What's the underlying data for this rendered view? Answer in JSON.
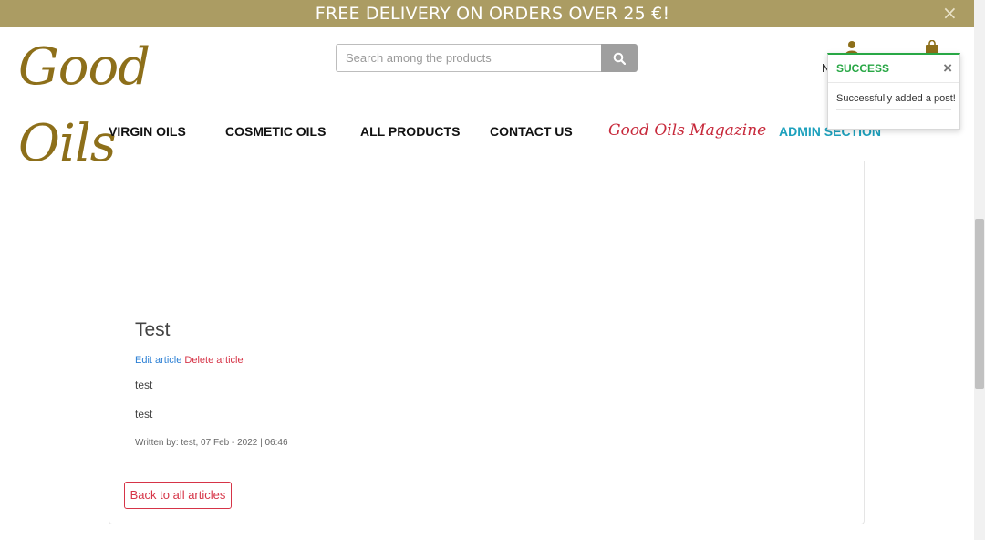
{
  "promo": {
    "text": "FREE DELIVERY ON ORDERS OVER 25 €!",
    "close": "×"
  },
  "logo": {
    "text": "Good Oils"
  },
  "search": {
    "placeholder": "Search among the products",
    "icon": "search-icon"
  },
  "nav": {
    "items": [
      {
        "label": "VIRGIN OILS"
      },
      {
        "label": "COSMETIC OILS"
      },
      {
        "label": "ALL PRODUCTS"
      },
      {
        "label": "CONTACT US"
      },
      {
        "label": "Good Oils Magazine"
      },
      {
        "label": "ADMIN SECTION"
      }
    ]
  },
  "header_right": {
    "user_partial": "N"
  },
  "toast": {
    "title": "SUCCESS",
    "close": "×",
    "message": "Successfully added a post!"
  },
  "article": {
    "title": "Test",
    "edit": "Edit article",
    "delete": "Delete article",
    "paragraphs": [
      "test",
      "test"
    ],
    "meta": "Written by: test, 07 Feb - 2022 | 06:46",
    "back": "Back to all articles"
  },
  "colors": {
    "promo_bg": "#ab9c63",
    "logo": "#8d6f1a",
    "magazine": "#c7293b",
    "admin": "#1da1bd",
    "success": "#28a745",
    "danger": "#d63447",
    "link": "#2b7fd4"
  }
}
